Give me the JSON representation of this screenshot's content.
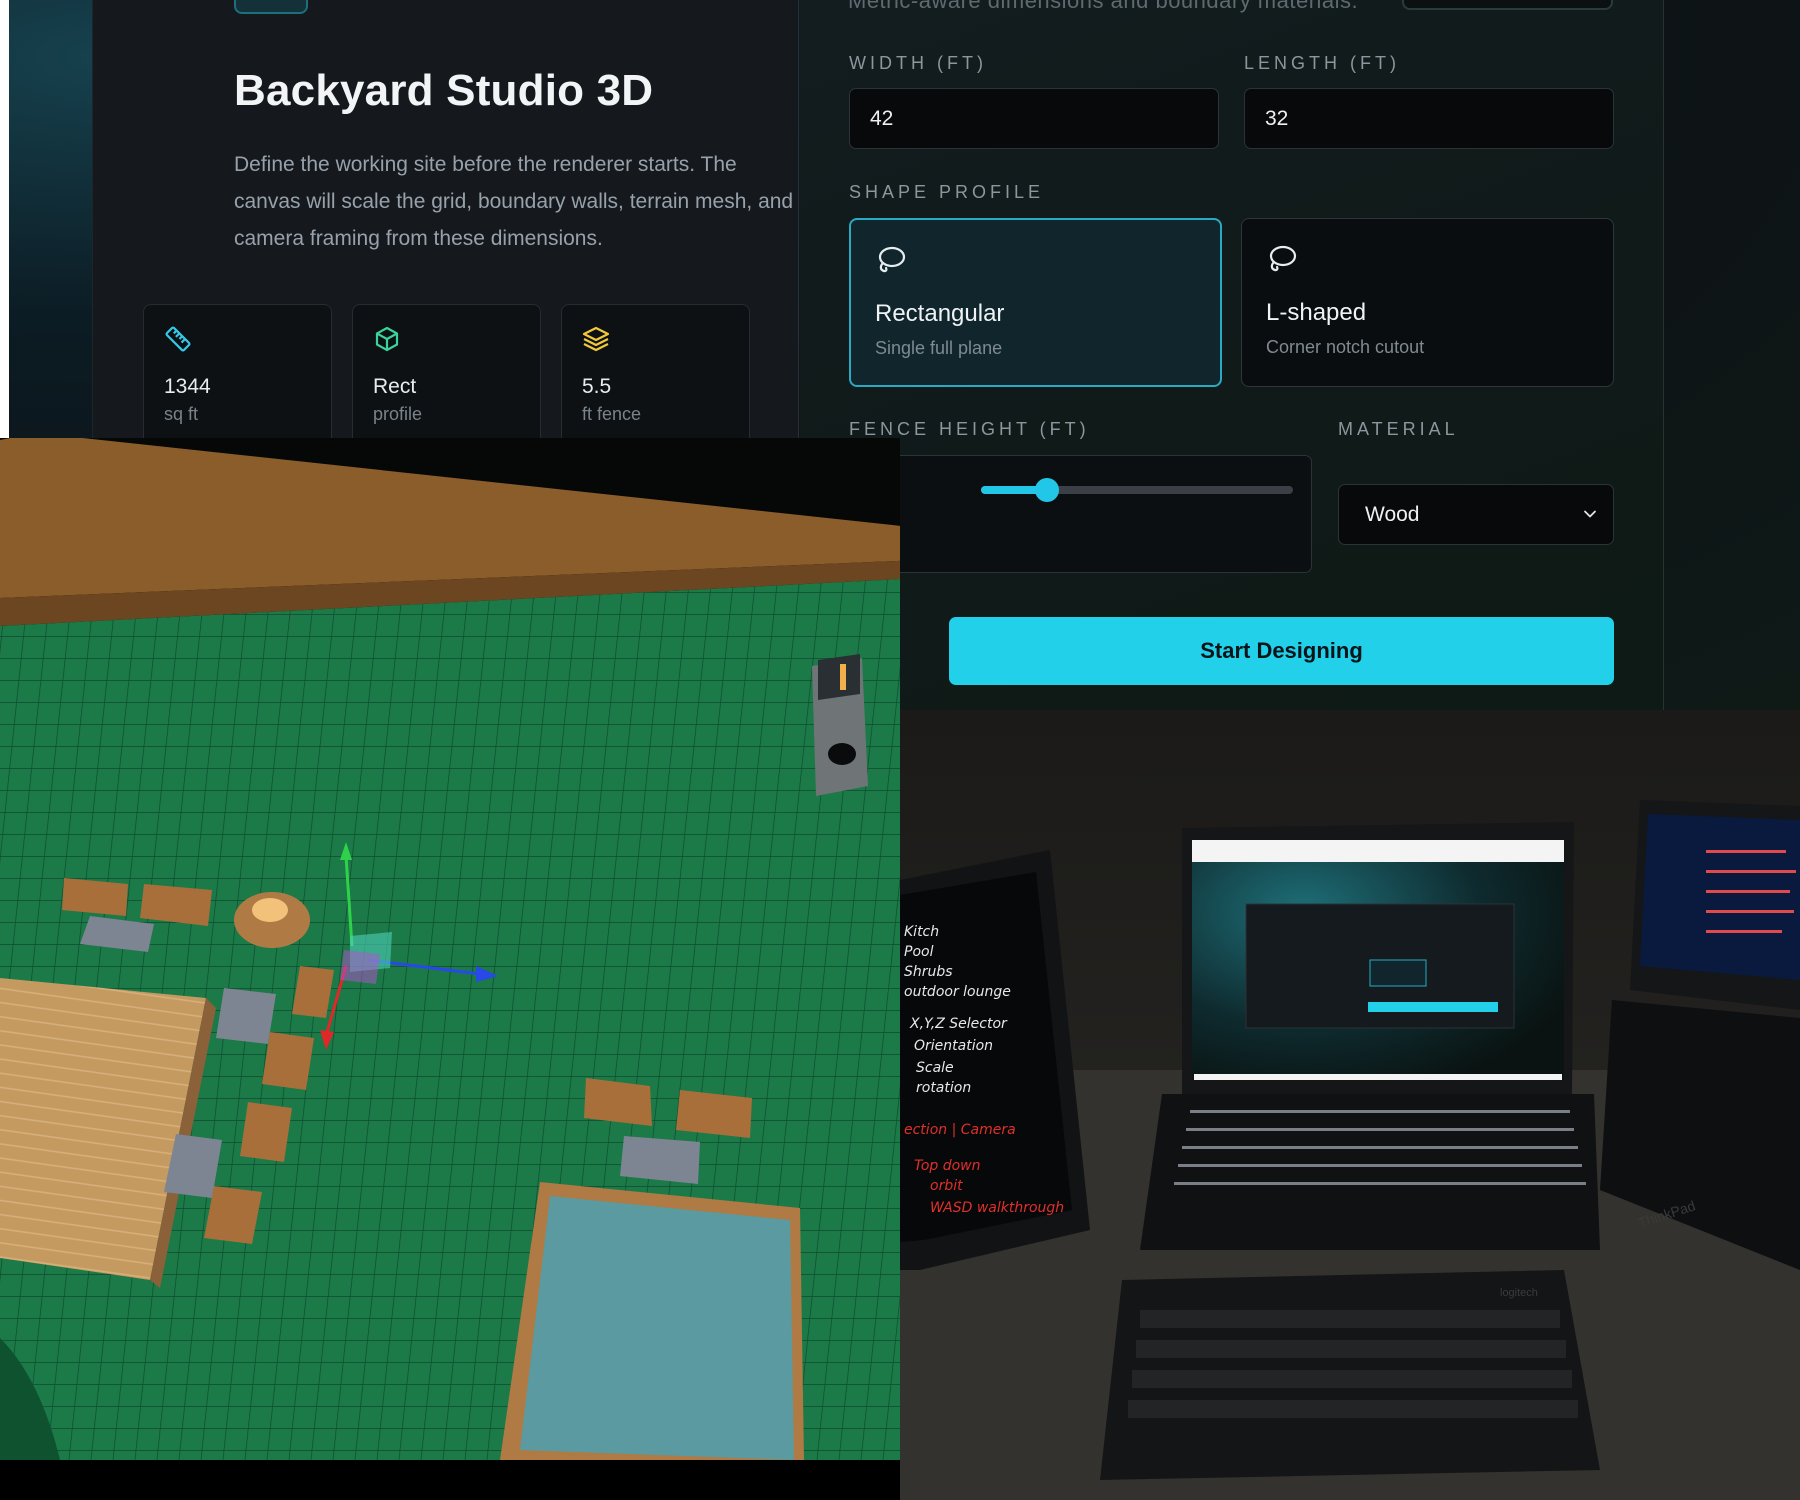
{
  "setup": {
    "title": "Backyard Studio 3D",
    "description": "Define the working site before the renderer starts. The canvas will scale the grid, boundary walls, terrain mesh, and camera framing from these dimensions.",
    "subtitle_cut": "Metric-aware dimensions and boundary materials.",
    "stats": [
      {
        "icon": "ruler-icon",
        "value": "1344",
        "unit": "sq ft",
        "color": "#35c9e8"
      },
      {
        "icon": "cube-icon",
        "value": "Rect",
        "unit": "profile",
        "color": "#3ad39a"
      },
      {
        "icon": "layers-icon",
        "value": "5.5",
        "unit": "ft fence",
        "color": "#f1c93a"
      }
    ],
    "width": {
      "label": "WIDTH (FT)",
      "value": "42"
    },
    "length": {
      "label": "LENGTH (FT)",
      "value": "32"
    },
    "shape_profile": {
      "label": "SHAPE PROFILE",
      "options": [
        {
          "name": "Rectangular",
          "sub": "Single full plane",
          "selected": true
        },
        {
          "name": "L-shaped",
          "sub": "Corner notch cutout",
          "selected": false
        }
      ]
    },
    "fence_height": {
      "label": "FENCE HEIGHT (FT)",
      "fill_fraction": 0.21
    },
    "material": {
      "label": "MATERIAL",
      "value": "Wood"
    },
    "start_button": "Start Designing",
    "accent_color": "#22d0ea"
  },
  "photo": {
    "laptop_brand": "ThinkPad",
    "keyboard_brand": "logitech",
    "notes_lines": [
      "Kitch",
      "Pool",
      "Shrubs",
      "outdoor lounge",
      "X,Y,Z Selector",
      "Orientation",
      "Scale",
      "rotation",
      "ection | Camera",
      "Top down",
      "orbit",
      "WASD walkthrough"
    ]
  }
}
